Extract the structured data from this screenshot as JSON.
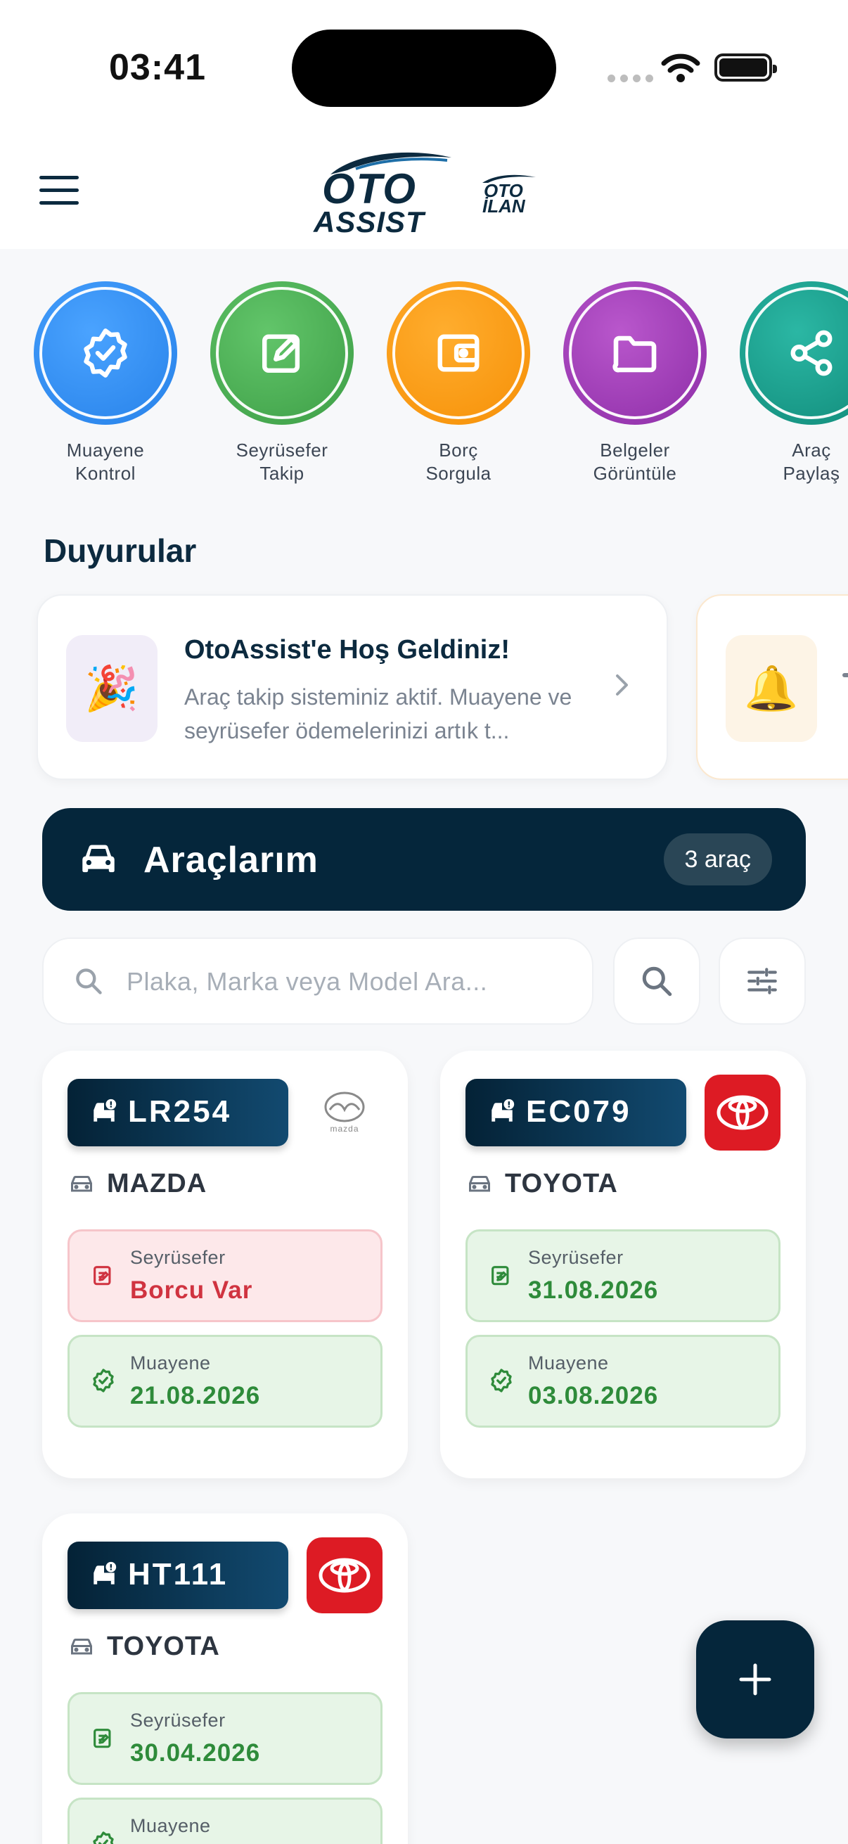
{
  "status_bar": {
    "time": "03:41"
  },
  "header": {
    "logo_main_top": "OTO",
    "logo_main_bottom": "ASSIST",
    "logo_secondary_top": "OTO",
    "logo_secondary_bottom": "İLAN"
  },
  "quick_actions": [
    {
      "label": "Muayene\nKontrol",
      "icon": "badge-check-icon",
      "color": "#2f8cf0"
    },
    {
      "label": "Seyrüsefer\nTakip",
      "icon": "edit-square-icon",
      "color": "#46ad4e"
    },
    {
      "label": "Borç\nSorgula",
      "icon": "wallet-icon",
      "color": "#f99b10"
    },
    {
      "label": "Belgeler\nGörüntüle",
      "icon": "folder-icon",
      "color": "#a03db7"
    },
    {
      "label": "Araç\nPaylaş",
      "icon": "share-icon",
      "color": "#17a08e"
    }
  ],
  "announcements": {
    "title": "Duyurular",
    "items": [
      {
        "icon": "party-popper-icon",
        "emoji": "🎉",
        "title": "OtoAssist'e Hoş Geldiniz!",
        "body": "Araç takip sisteminiz aktif. Muayene ve seyrüsefer ödemelerinizi artık t..."
      },
      {
        "icon": "bell-icon",
        "emoji": "🔔",
        "title": "",
        "body": ""
      }
    ]
  },
  "vehicles": {
    "title": "Araçlarım",
    "count": "3 araç",
    "search_placeholder": "Plaka, Marka veya Model Ara...",
    "cards": [
      {
        "plate": "LR254",
        "brand": "MAZDA",
        "brand_logo": "mazda",
        "seyrusefer_label": "Seyrüsefer",
        "seyrusefer_value": "Borcu Var",
        "seyrusefer_status": "red",
        "muayene_label": "Muayene",
        "muayene_value": "21.08.2026",
        "muayene_status": "green"
      },
      {
        "plate": "EC079",
        "brand": "TOYOTA",
        "brand_logo": "toyota",
        "seyrusefer_label": "Seyrüsefer",
        "seyrusefer_value": "31.08.2026",
        "seyrusefer_status": "green",
        "muayene_label": "Muayene",
        "muayene_value": "03.08.2026",
        "muayene_status": "green"
      },
      {
        "plate": "HT111",
        "brand": "TOYOTA",
        "brand_logo": "toyota",
        "seyrusefer_label": "Seyrüsefer",
        "seyrusefer_value": "30.04.2026",
        "seyrusefer_status": "green",
        "muayene_label": "Muayene",
        "muayene_value": "",
        "muayene_status": "green"
      }
    ]
  },
  "mazda_wordmark": "mazda"
}
